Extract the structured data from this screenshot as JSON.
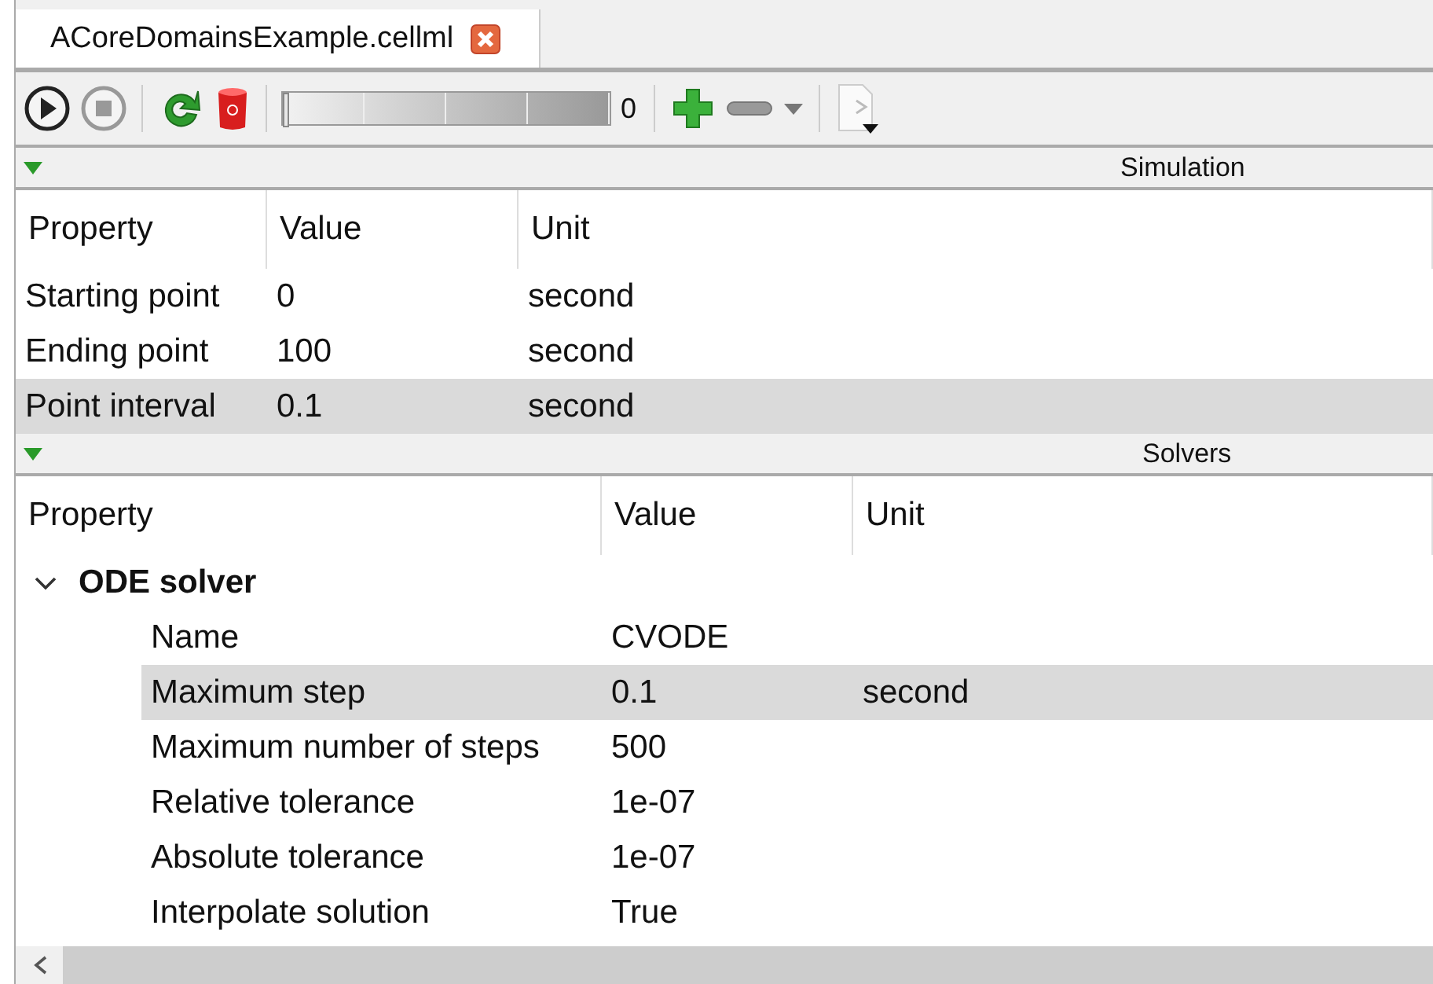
{
  "tabs": [
    {
      "label": "ACoreDomainsExample.cellml",
      "selected": true
    }
  ],
  "delay": {
    "level": 0,
    "reading": "0"
  },
  "simulation": {
    "title": "Simulation",
    "expanded": true,
    "columns": [
      "Property",
      "Value",
      "Unit"
    ],
    "rows": [
      {
        "property": "Starting point",
        "value": "0",
        "unit": "second",
        "selected": false
      },
      {
        "property": "Ending point",
        "value": "100",
        "unit": "second",
        "selected": false
      },
      {
        "property": "Point interval",
        "value": "0.1",
        "unit": "second",
        "selected": true
      }
    ]
  },
  "solvers": {
    "title": "Solvers",
    "expanded": true,
    "columns": [
      "Property",
      "Value",
      "Unit"
    ],
    "groups": [
      {
        "label": "ODE solver",
        "expanded": true,
        "children": [
          {
            "property": "Name",
            "value": "CVODE",
            "selected": false
          },
          {
            "property": "Maximum step",
            "value": "0.1",
            "unit": "second",
            "selected": true
          },
          {
            "property": "Maximum number of steps",
            "value": "500",
            "selected": false
          },
          {
            "property": "Relative tolerance",
            "value": "1e-07",
            "selected": false
          },
          {
            "property": "Absolute tolerance",
            "value": "1e-07",
            "selected": false
          },
          {
            "property": "Interpolate solution",
            "value": "True",
            "selected": false
          }
        ]
      }
    ]
  }
}
